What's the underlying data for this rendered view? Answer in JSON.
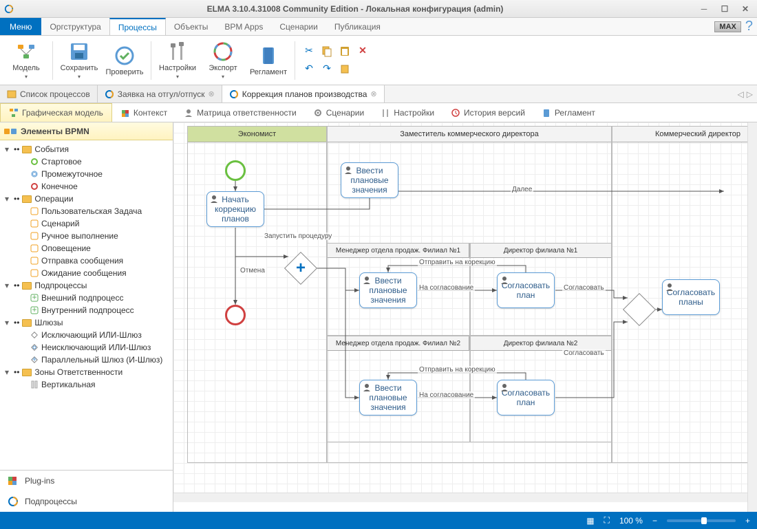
{
  "title": "ELMA 3.10.4.31008 Community Edition - Локальная конфигурация (admin)",
  "menu_button": "Меню",
  "menu": {
    "org": "Оргструктура",
    "proc": "Процессы",
    "obj": "Объекты",
    "bpm": "BPM Apps",
    "scen": "Сценарии",
    "pub": "Публикация"
  },
  "max_badge": "MAX",
  "ribbon": {
    "model": "Модель",
    "save": "Сохранить",
    "check": "Проверить",
    "settings": "Настройки",
    "export": "Экспорт",
    "reglament": "Регламент"
  },
  "doc_tabs": {
    "list": "Список процессов",
    "leave": "Заявка на отгул/отпуск",
    "correction": "Коррекция планов производства"
  },
  "subtabs": {
    "graphic": "Графическая модель",
    "context": "Контекст",
    "matrix": "Матрица ответственности",
    "scenarios": "Сценарии",
    "settings": "Настройки",
    "history": "История версий",
    "reglament": "Регламент"
  },
  "sidebar_header": "Элементы BPMN",
  "tree": {
    "events": "События",
    "start": "Стартовое",
    "inter": "Промежуточное",
    "end": "Конечное",
    "ops": "Операции",
    "user_task": "Пользовательская Задача",
    "script": "Сценарий",
    "manual": "Ручное выполнение",
    "notify": "Оповещение",
    "send": "Отправка сообщения",
    "wait": "Ожидание сообщения",
    "subs": "Подпроцессы",
    "ext_sub": "Внешний подпроцесс",
    "int_sub": "Внутренний подпроцесс",
    "gates": "Шлюзы",
    "xor": "Исключающий ИЛИ-Шлюз",
    "or": "Неисключающий ИЛИ-Шлюз",
    "and": "Параллельный Шлюз (И-Шлюз)",
    "zones": "Зоны Ответственности",
    "vert": "Вертикальная"
  },
  "sidebar_footer": {
    "plugins": "Plug-ins",
    "subprocesses": "Подпроцессы"
  },
  "lanes": {
    "econ": "Экономист",
    "zam": "Заместитель коммерческого директора",
    "kom": "Коммерческий директор"
  },
  "sublanes": {
    "mgr1": "Менеджер отдела продаж. Филиал №1",
    "dir1": "Директор филиала №1",
    "mgr2": "Менеджер отдела продаж. Филиал №2",
    "dir2": "Директор филиала №2"
  },
  "tasks": {
    "begin": "Начать коррекцию планов",
    "enter1": "Ввести плановые значения",
    "enter2": "Ввести плановые значения",
    "enter3": "Ввести плановые значения",
    "agree1": "Согласовать план",
    "agree2": "Согласовать план",
    "agree_plans": "Согласовать планы"
  },
  "edges": {
    "cancel": "Отмена",
    "launch": "Запустить процедуру",
    "next": "Далее",
    "send_corr": "Отправить на корекцию",
    "to_agree": "На согласование",
    "agree": "Согласовать"
  },
  "status": {
    "zoom": "100 %"
  }
}
